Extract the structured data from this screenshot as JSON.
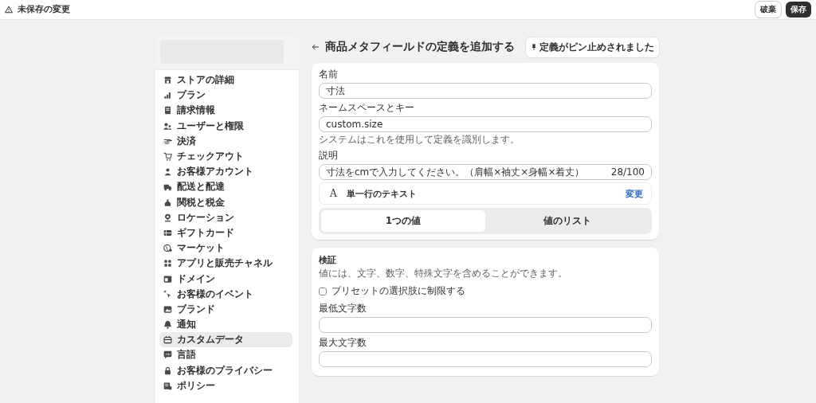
{
  "top_bar": {
    "title": "未保存の変更",
    "buttons": [
      {
        "label": "破棄",
        "kind": "secondary"
      },
      {
        "label": "保存",
        "kind": "primary"
      }
    ]
  },
  "sidebar": {
    "items": [
      {
        "label": "ストアの詳細",
        "selected": false
      },
      {
        "label": "プラン",
        "selected": false
      },
      {
        "label": "請求情報",
        "selected": false
      },
      {
        "label": "ユーザーと権限",
        "selected": false
      },
      {
        "label": "決済",
        "selected": false
      },
      {
        "label": "チェックアウト",
        "selected": false
      },
      {
        "label": "お客様アカウント",
        "selected": false
      },
      {
        "label": "配送と配達",
        "selected": false
      },
      {
        "label": "関税と税金",
        "selected": false
      },
      {
        "label": "ロケーション",
        "selected": false
      },
      {
        "label": "ギフトカード",
        "selected": false
      },
      {
        "label": "マーケット",
        "selected": false
      },
      {
        "label": "アプリと販売チャネル",
        "selected": false
      },
      {
        "label": "ドメイン",
        "selected": false
      },
      {
        "label": "お客様のイベント",
        "selected": false
      },
      {
        "label": "ブランド",
        "selected": false
      },
      {
        "label": "通知",
        "selected": false
      },
      {
        "label": "カスタムデータ",
        "selected": true
      },
      {
        "label": "言語",
        "selected": false
      },
      {
        "label": "お客様のプライバシー",
        "selected": false
      },
      {
        "label": "ポリシー",
        "selected": false
      }
    ]
  },
  "page": {
    "title": "商品メタフィールドの定義を追加する",
    "pin_button": "定義がピン止めされました"
  },
  "definition_card": {
    "name": {
      "label": "名前",
      "value": "寸法"
    },
    "namespace": {
      "label": "ネームスペースとキー",
      "value": "custom.size",
      "help": "システムはこれを使用して定義を識別します。"
    },
    "description": {
      "label": "説明",
      "value": "寸法をcmで入力してください。（肩幅×袖丈×身幅×着丈）",
      "counter": "28/100"
    },
    "type": {
      "icon_letter": "A",
      "label": "単一行のテキスト",
      "action": "変更"
    },
    "value_mode": [
      {
        "label": "1つの値",
        "selected": true
      },
      {
        "label": "値のリスト",
        "selected": false
      }
    ]
  },
  "validation_card": {
    "title": "検証",
    "description": "値には、文字、数字、特殊文字を含めることができます。",
    "preset_checkbox": {
      "label": "プリセットの選択肢に制限する",
      "checked": false
    },
    "fields": [
      {
        "label": "最低文字数"
      },
      {
        "label": "最大文字数"
      }
    ]
  }
}
